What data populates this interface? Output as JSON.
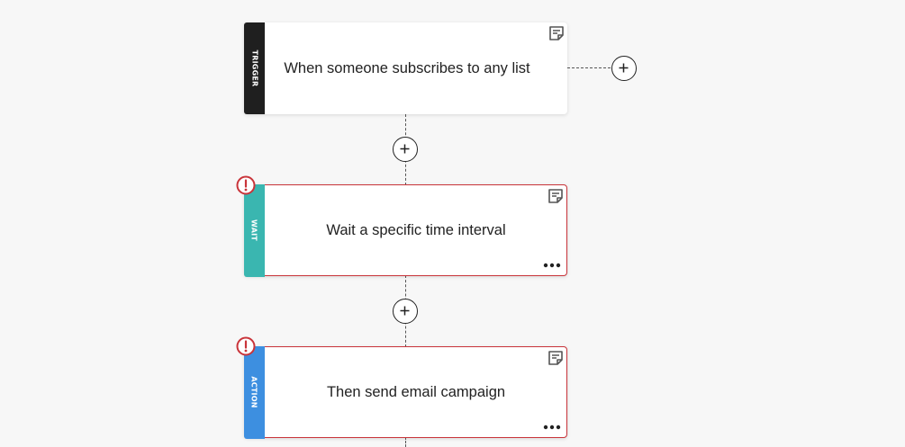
{
  "nodes": [
    {
      "id": "trigger",
      "type_label": "TRIGGER",
      "title": "When someone subscribes to any list",
      "color": "#1f1f1f",
      "has_error": false,
      "has_menu": false
    },
    {
      "id": "wait",
      "type_label": "WAIT",
      "title": "Wait a specific time interval",
      "color": "#3ab6b0",
      "has_error": true,
      "has_menu": true
    },
    {
      "id": "action",
      "type_label": "ACTION",
      "title": "Then send email campaign",
      "color": "#3d8fe0",
      "has_error": true,
      "has_menu": true
    }
  ],
  "icons": {
    "add": "plus-circle-icon",
    "note": "note-icon",
    "more": "more-horizontal-icon",
    "error": "exclamation-circle-icon"
  },
  "colors": {
    "canvas_background": "#f7f7f7",
    "error_border": "#c9343a",
    "connector": "#555555"
  }
}
